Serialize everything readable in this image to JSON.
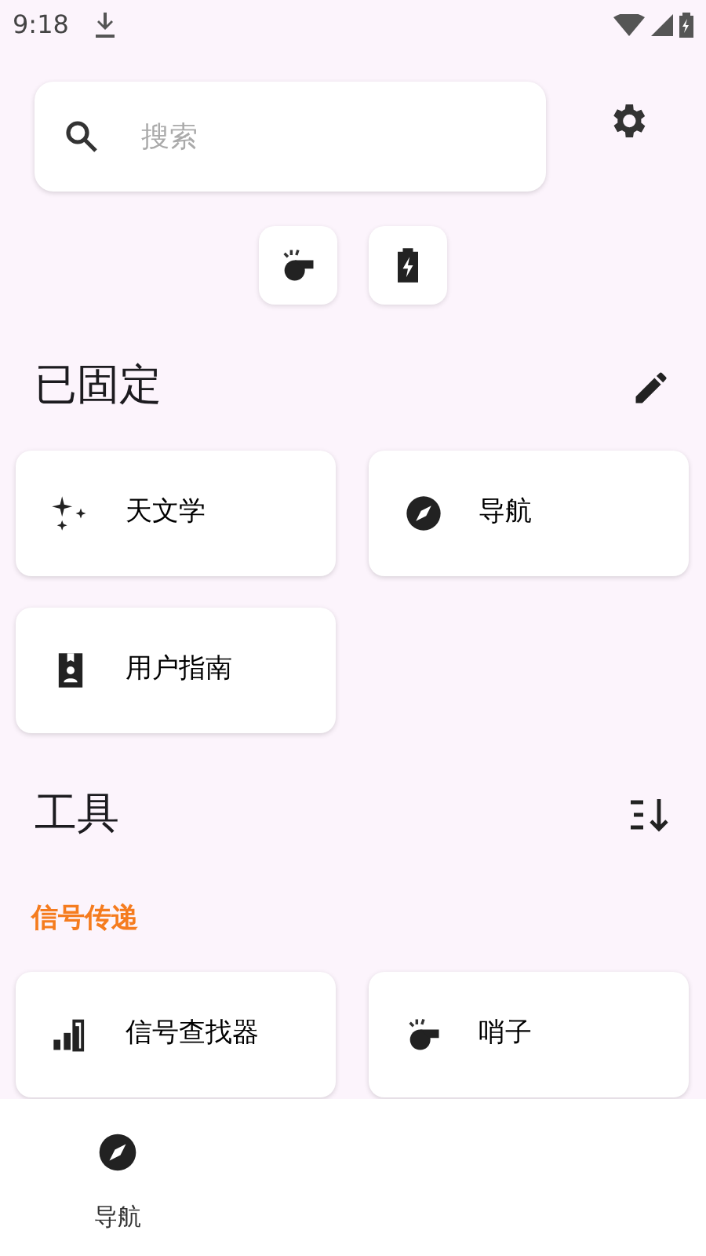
{
  "status_bar": {
    "time": "9:18"
  },
  "search": {
    "placeholder": "搜索"
  },
  "quick_actions": [
    {
      "kind": "whistle"
    },
    {
      "kind": "battery"
    }
  ],
  "pinned": {
    "title": "已固定",
    "tools": [
      {
        "label": "天文学",
        "kind": "sparkles"
      },
      {
        "label": "导航",
        "kind": "compass"
      },
      {
        "label": "用户指南",
        "kind": "guide"
      }
    ]
  },
  "tools": {
    "title": "工具",
    "categories": [
      {
        "name": "信号传递",
        "color": "#f57c1f",
        "tools": [
          {
            "label": "信号查找器",
            "kind": "signal"
          },
          {
            "label": "哨子",
            "kind": "whistle"
          }
        ]
      }
    ]
  },
  "bottom_nav": [
    {
      "label": "导航",
      "kind": "compass"
    }
  ]
}
